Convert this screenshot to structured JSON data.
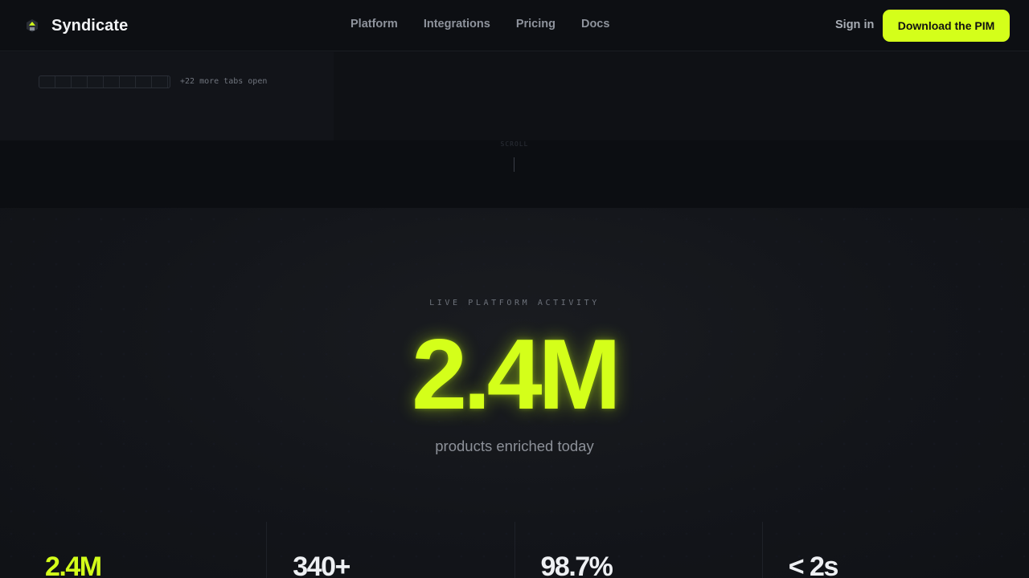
{
  "nav": {
    "brand": "Syndicate",
    "links": [
      "Platform",
      "Integrations",
      "Pricing",
      "Docs"
    ],
    "sign_in": "Sign in",
    "cta": "Download the PIM"
  },
  "tabs": {
    "more_label": "+22 more tabs open"
  },
  "scroll": {
    "label": "SCROLL"
  },
  "hero": {
    "eyebrow": "LIVE PLATFORM ACTIVITY",
    "big_number": "2.4M",
    "subtitle": "products enriched today"
  },
  "stats": [
    {
      "value": "2.4M"
    },
    {
      "value": "340+"
    },
    {
      "value": "98.7%"
    },
    {
      "value": "< 2s"
    }
  ],
  "colors": {
    "accent": "#d4ff1a",
    "background": "#0f1115"
  }
}
